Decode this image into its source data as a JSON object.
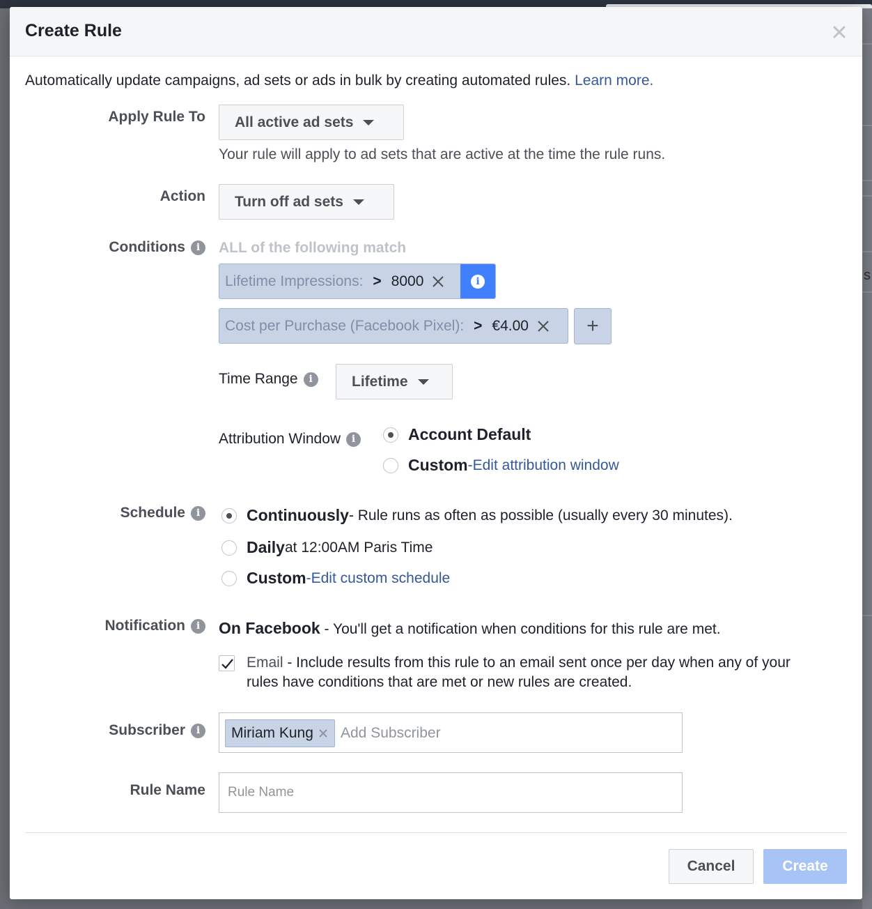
{
  "modal": {
    "title": "Create Rule",
    "intro": "Automatically update campaigns, ad sets or ads in bulk by creating automated rules.",
    "learn_more": "Learn more."
  },
  "apply_rule": {
    "label": "Apply Rule To",
    "value": "All active ad sets",
    "helper": "Your rule will apply to ad sets that are active at the time the rule runs."
  },
  "action": {
    "label": "Action",
    "value": "Turn off ad sets"
  },
  "conditions": {
    "label": "Conditions",
    "match": "ALL of the following match",
    "items": [
      {
        "field": "Lifetime Impressions:",
        "operator": ">",
        "value": "8000"
      },
      {
        "field": "Cost per Purchase (Facebook Pixel):",
        "operator": ">",
        "value": "€4.00"
      }
    ],
    "add_label": "+"
  },
  "time_range": {
    "label": "Time Range",
    "value": "Lifetime"
  },
  "attribution": {
    "label": "Attribution Window",
    "options": [
      {
        "label": "Account Default",
        "selected": true
      },
      {
        "label": "Custom",
        "selected": false,
        "separator": " - ",
        "link": "Edit attribution window"
      }
    ]
  },
  "schedule": {
    "label": "Schedule",
    "options": [
      {
        "label": "Continuously",
        "detail": " - Rule runs as often as possible (usually every 30 minutes).",
        "selected": true
      },
      {
        "label": "Daily",
        "detail": " at 12:00AM Paris Time",
        "selected": false
      },
      {
        "label": "Custom",
        "separator": " - ",
        "link": "Edit custom schedule",
        "selected": false
      }
    ]
  },
  "notification": {
    "label": "Notification",
    "channel": "On Facebook",
    "channel_detail": " - You'll get a notification when conditions for this rule are met.",
    "email_label": "Email",
    "email_detail": " - Include results from this rule to an email sent once per day when any of your rules have conditions that are met or new rules are created.",
    "email_checked": true
  },
  "subscriber": {
    "label": "Subscriber",
    "tokens": [
      "Miriam Kung"
    ],
    "placeholder": "Add Subscriber"
  },
  "rule_name": {
    "label": "Rule Name",
    "placeholder": "Rule Name",
    "value": ""
  },
  "footer": {
    "cancel": "Cancel",
    "create": "Create"
  },
  "background": {
    "edge_glyph": "s"
  },
  "colors": {
    "link": "#365899",
    "accent": "#4080ff",
    "create_disabled": "#a8c4f6",
    "token_bg": "#c8d3e5"
  },
  "icons": {
    "close": "close-icon",
    "info": "info-icon",
    "caret": "caret-down-icon",
    "remove": "remove-x-icon",
    "checkmark": "checkmark-icon"
  }
}
